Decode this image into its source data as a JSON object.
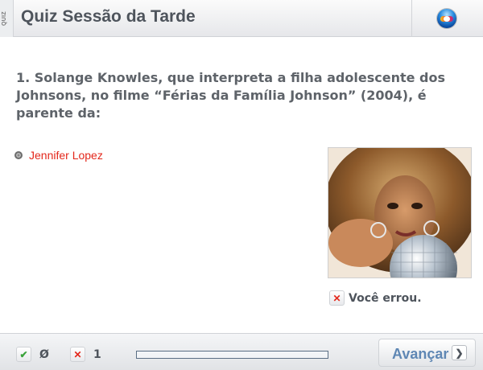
{
  "header": {
    "tab_label": "QUIZ",
    "title": "Quiz Sessão da Tarde",
    "logo_icon": "globo-logo-icon"
  },
  "question": {
    "text": "1. Solange Knowles, que interpreta a filha adolescente dos Johnsons, no filme “Férias da Família Johnson” (2004), é parente da:"
  },
  "options": [
    {
      "label": "Jennifer Lopez",
      "state": "selected-wrong",
      "color": "#e3271b"
    }
  ],
  "result": {
    "icon": "x-icon",
    "text": "Você errou."
  },
  "footer": {
    "correct_icon": "checkmark-icon",
    "correct_count": "Ø",
    "wrong_icon": "x-icon",
    "wrong_count": "1",
    "progress_fraction": 0,
    "advance_label": "Avançar",
    "advance_icon": "chevron-right-icon"
  },
  "colors": {
    "accent_blue": "#5f87b4",
    "error_red": "#e3271b",
    "success_green": "#3aa23a"
  }
}
